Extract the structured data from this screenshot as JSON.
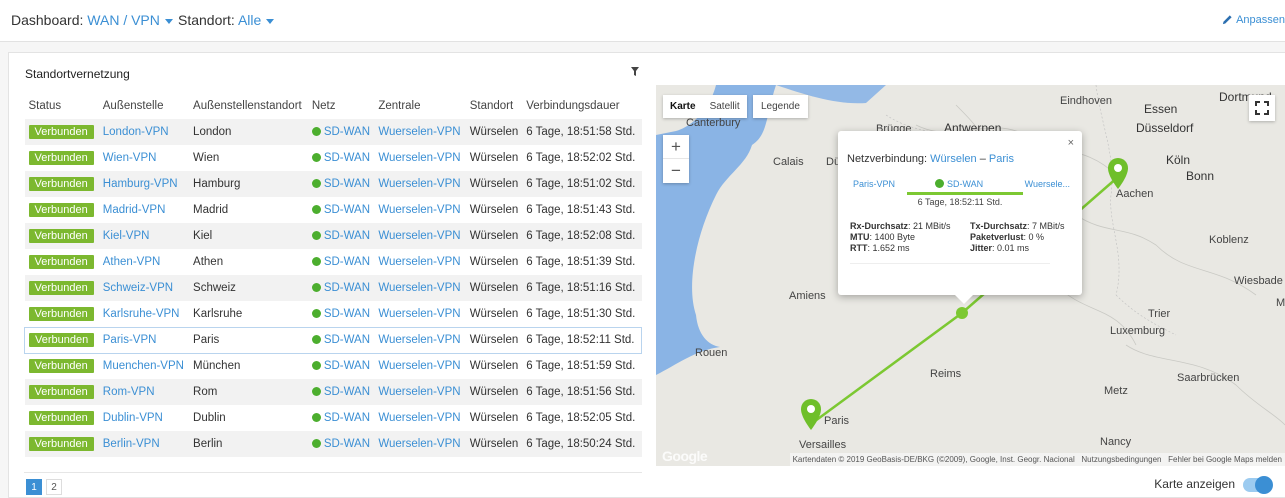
{
  "header": {
    "dashboard_label": "Dashboard:",
    "dashboard_value": "WAN / VPN",
    "location_label": "Standort:",
    "location_value": "Alle",
    "customize_label": "Anpassen"
  },
  "panel": {
    "title": "Standortvernetzung",
    "columns": [
      "Status",
      "Außenstelle",
      "Außenstellenstandort",
      "Netz",
      "Zentrale",
      "Standort",
      "Verbindungsdauer"
    ],
    "rows": [
      {
        "status": "Verbunden",
        "branch": "London-VPN",
        "branch_location": "London",
        "net": "SD-WAN",
        "hub": "Wuerselen-VPN",
        "location": "Würselen",
        "duration": "6 Tage, 18:51:58 Std."
      },
      {
        "status": "Verbunden",
        "branch": "Wien-VPN",
        "branch_location": "Wien",
        "net": "SD-WAN",
        "hub": "Wuerselen-VPN",
        "location": "Würselen",
        "duration": "6 Tage, 18:52:02 Std."
      },
      {
        "status": "Verbunden",
        "branch": "Hamburg-VPN",
        "branch_location": "Hamburg",
        "net": "SD-WAN",
        "hub": "Wuerselen-VPN",
        "location": "Würselen",
        "duration": "6 Tage, 18:51:02 Std."
      },
      {
        "status": "Verbunden",
        "branch": "Madrid-VPN",
        "branch_location": "Madrid",
        "net": "SD-WAN",
        "hub": "Wuerselen-VPN",
        "location": "Würselen",
        "duration": "6 Tage, 18:51:43 Std."
      },
      {
        "status": "Verbunden",
        "branch": "Kiel-VPN",
        "branch_location": "Kiel",
        "net": "SD-WAN",
        "hub": "Wuerselen-VPN",
        "location": "Würselen",
        "duration": "6 Tage, 18:52:08 Std."
      },
      {
        "status": "Verbunden",
        "branch": "Athen-VPN",
        "branch_location": "Athen",
        "net": "SD-WAN",
        "hub": "Wuerselen-VPN",
        "location": "Würselen",
        "duration": "6 Tage, 18:51:39 Std."
      },
      {
        "status": "Verbunden",
        "branch": "Schweiz-VPN",
        "branch_location": "Schweiz",
        "net": "SD-WAN",
        "hub": "Wuerselen-VPN",
        "location": "Würselen",
        "duration": "6 Tage, 18:51:16 Std."
      },
      {
        "status": "Verbunden",
        "branch": "Karlsruhe-VPN",
        "branch_location": "Karlsruhe",
        "net": "SD-WAN",
        "hub": "Wuerselen-VPN",
        "location": "Würselen",
        "duration": "6 Tage, 18:51:30 Std."
      },
      {
        "status": "Verbunden",
        "branch": "Paris-VPN",
        "branch_location": "Paris",
        "net": "SD-WAN",
        "hub": "Wuerselen-VPN",
        "location": "Würselen",
        "duration": "6 Tage, 18:52:11 Std."
      },
      {
        "status": "Verbunden",
        "branch": "Muenchen-VPN",
        "branch_location": "München",
        "net": "SD-WAN",
        "hub": "Wuerselen-VPN",
        "location": "Würselen",
        "duration": "6 Tage, 18:51:59 Std."
      },
      {
        "status": "Verbunden",
        "branch": "Rom-VPN",
        "branch_location": "Rom",
        "net": "SD-WAN",
        "hub": "Wuerselen-VPN",
        "location": "Würselen",
        "duration": "6 Tage, 18:51:56 Std."
      },
      {
        "status": "Verbunden",
        "branch": "Dublin-VPN",
        "branch_location": "Dublin",
        "net": "SD-WAN",
        "hub": "Wuerselen-VPN",
        "location": "Würselen",
        "duration": "6 Tage, 18:52:05 Std."
      },
      {
        "status": "Verbunden",
        "branch": "Berlin-VPN",
        "branch_location": "Berlin",
        "net": "SD-WAN",
        "hub": "Wuerselen-VPN",
        "location": "Würselen",
        "duration": "6 Tage, 18:50:24 Std."
      }
    ],
    "selected_row": 8,
    "pages": [
      "1",
      "2"
    ],
    "active_page": "1"
  },
  "map": {
    "type_karte": "Karte",
    "type_satellit": "Satellit",
    "legend_label": "Legende",
    "zoom_in": "+",
    "zoom_out": "−",
    "cities": [
      "Dortmund",
      "Eindhoven",
      "Essen",
      "Canterbury",
      "Brügge",
      "Antwerpen",
      "Düsseldorf",
      "Calais",
      "Dün",
      "Köln",
      "Bonn",
      "Aachen",
      "Koblenz",
      "Wiesbade",
      "Amiens",
      "Trier",
      "Luxemburg",
      "Rouen",
      "Reims",
      "Saarbrücken",
      "Metz",
      "Paris",
      "Versailles",
      "Nancy",
      "M"
    ],
    "attribution": "Kartendaten © 2019 GeoBasis-DE/BKG (©2009), Google, Inst. Geogr. Nacional",
    "terms": "Nutzungsbedingungen",
    "report": "Fehler bei Google Maps melden",
    "logo": "Google",
    "popup": {
      "title_prefix": "Netzverbindung:",
      "from": "Würselen",
      "dash": "–",
      "to": "Paris",
      "branch": "Paris-VPN",
      "net": "SD-WAN",
      "hub": "Wuersele...",
      "duration": "6 Tage, 18:52:11 Std.",
      "rx_label": "Rx-Durchsatz",
      "rx_value": ": 21 MBit/s",
      "tx_label": "Tx-Durchsatz",
      "tx_value": ": 7 MBit/s",
      "mtu_label": "MTU",
      "mtu_value": ": 1400 Byte",
      "loss_label": "Paketverlust",
      "loss_value": ": 0 %",
      "rtt_label": "RTT",
      "rtt_value": ": 1.652 ms",
      "jitter_label": "Jitter",
      "jitter_value": ": 0.01 ms",
      "close": "×"
    },
    "line_color": "#7cc832",
    "marker_color": "#6fbf2a"
  },
  "footer": {
    "map_toggle_label": "Karte anzeigen"
  },
  "colors": {
    "accent": "#3b8fd4",
    "status_green": "#7cb82f",
    "net_dot": "#4cae2e"
  }
}
